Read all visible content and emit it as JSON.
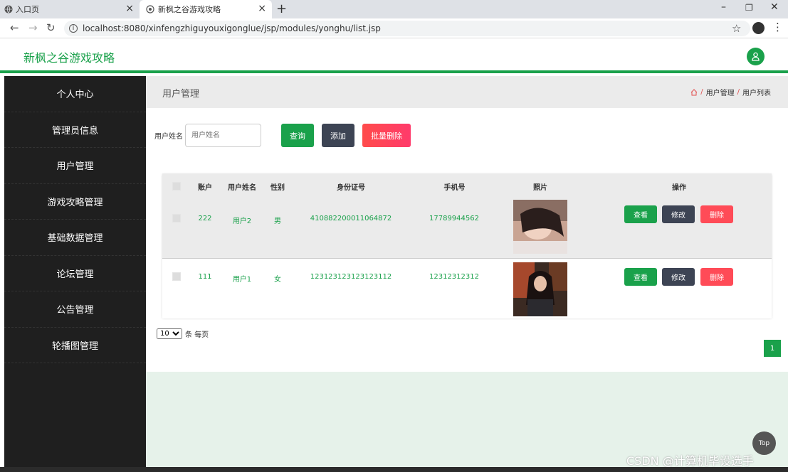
{
  "browser": {
    "tabs": [
      {
        "title": "入口页"
      },
      {
        "title": "新枫之谷游戏攻略"
      }
    ],
    "url": "localhost:8080/xinfengzhiguyouxigonglue/jsp/modules/yonghu/list.jsp",
    "new_tab": "+",
    "close_glyph": "×"
  },
  "app": {
    "brand": "新枫之谷游戏攻略",
    "accent": "#1aa14b"
  },
  "sidebar": {
    "items": [
      {
        "label": "个人中心"
      },
      {
        "label": "管理员信息"
      },
      {
        "label": "用户管理"
      },
      {
        "label": "游戏攻略管理"
      },
      {
        "label": "基础数据管理"
      },
      {
        "label": "论坛管理"
      },
      {
        "label": "公告管理"
      },
      {
        "label": "轮播图管理"
      }
    ]
  },
  "breadcrumb": {
    "title": "用户管理",
    "sep": "/",
    "trail": [
      "用户管理",
      "用户列表"
    ]
  },
  "search": {
    "label": "用户姓名",
    "placeholder": "用户姓名",
    "query_btn": "查询",
    "add_btn": "添加",
    "batch_delete_btn": "批量删除"
  },
  "table": {
    "headers": [
      "账户",
      "用户姓名",
      "性别",
      "身份证号",
      "手机号",
      "照片",
      "操作"
    ],
    "rows": [
      {
        "account": "222",
        "name": "用户2",
        "gender": "男",
        "id_number": "410882200011064872",
        "phone": "17789944562"
      },
      {
        "account": "111",
        "name": "用户1",
        "gender": "女",
        "id_number": "123123123123123112",
        "phone": "12312312312"
      }
    ],
    "actions": {
      "view": "查看",
      "edit": "修改",
      "delete": "删除"
    }
  },
  "pagination": {
    "page_size": "10",
    "per_page_label": "条 每页",
    "current_page": "1"
  },
  "top_button": "Top",
  "watermark": "CSDN @计算机毕设选手"
}
